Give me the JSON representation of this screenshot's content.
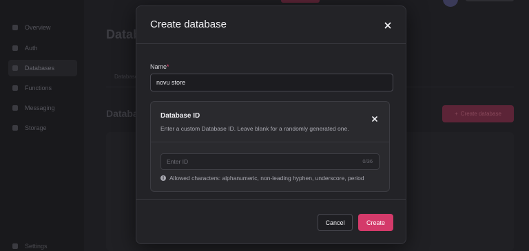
{
  "background": {
    "nav": [
      {
        "label": "Overview",
        "icon": "overview-icon"
      },
      {
        "label": "Auth",
        "icon": "auth-icon"
      },
      {
        "label": "Databases",
        "icon": "databases-icon",
        "active": true
      },
      {
        "label": "Functions",
        "icon": "functions-icon"
      },
      {
        "label": "Messaging",
        "icon": "messaging-icon"
      },
      {
        "label": "Storage",
        "icon": "storage-icon"
      }
    ],
    "settings_label": "Settings",
    "page_title": "Databases",
    "tab_label": "Databases",
    "section_title": "Databases",
    "create_button_label": "Create database"
  },
  "modal": {
    "title": "Create database",
    "close_icon": "close-icon",
    "name_field": {
      "label": "Name",
      "required_mark": "*",
      "value": "novu store"
    },
    "database_id": {
      "title": "Database ID",
      "description": "Enter a custom Database ID. Leave blank for a randomly generated one.",
      "input_placeholder": "Enter ID",
      "counter": "0/36",
      "hint": "Allowed characters: alphanumeric, non-leading hyphen, underscore, period",
      "hint_icon": "info-icon"
    },
    "cancel_label": "Cancel",
    "create_label": "Create"
  },
  "colors": {
    "accent": "#d43a6a",
    "required": "#f0487a",
    "modal_bg": "#232327",
    "overlay_bg": "#19191c"
  }
}
